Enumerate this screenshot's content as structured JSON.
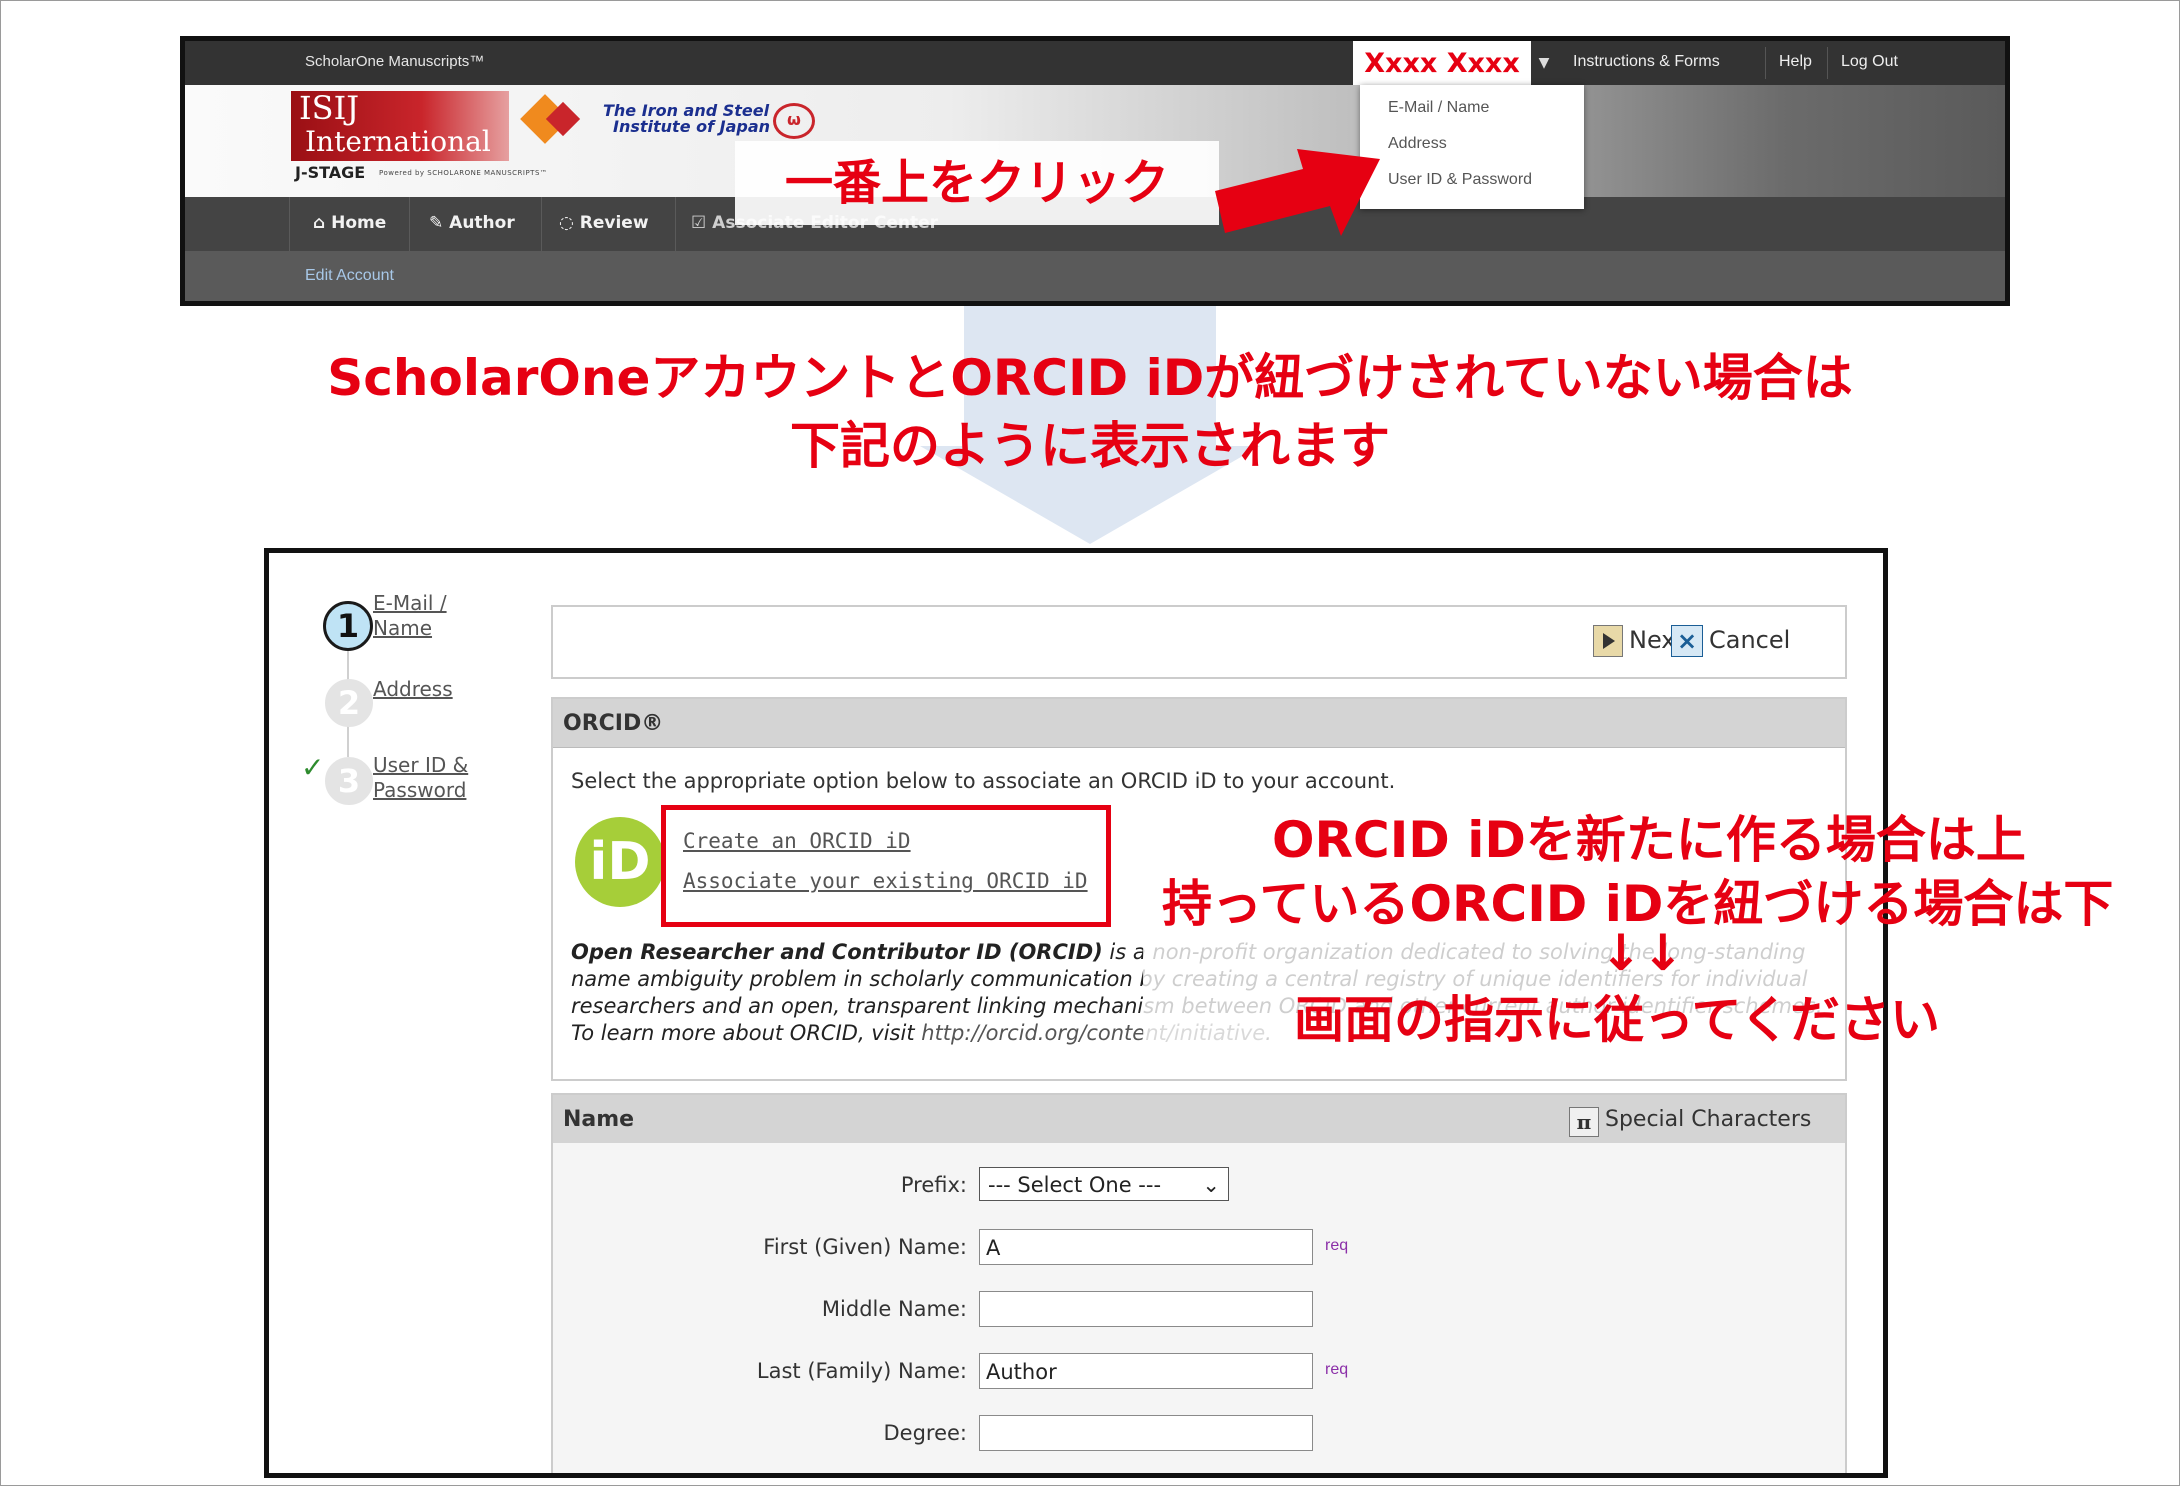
{
  "top_screenshot": {
    "app_name": "ScholarOne Manuscripts™",
    "user_name": "Xxxx Xxxx",
    "top_links": [
      "Instructions & Forms",
      "Help",
      "Log Out"
    ],
    "logo": {
      "line1": "ISIJ",
      "line2": "International",
      "org_line1": "The Iron and Steel",
      "org_line2": "Institute of Japan",
      "jstage": "J-STAGE",
      "powered": "Powered by SCHOLARONE MANUSCRIPTS™"
    },
    "nav": {
      "home": "Home",
      "author": "Author",
      "review": "Review",
      "associate_editor": "Associate Editor Center"
    },
    "subnav": "Edit Account",
    "dropdown": [
      "E-Mail / Name",
      "Address",
      "User ID & Password"
    ],
    "callout": "一番上をクリック"
  },
  "headline": {
    "line1": "ScholarOneアカウントとORCID iDが紐づけされていない場合は",
    "line2": "下記のように表示されます"
  },
  "bottom_screenshot": {
    "steps": [
      {
        "number": "1",
        "label": "E-Mail / Name"
      },
      {
        "number": "2",
        "label": "Address"
      },
      {
        "number": "3",
        "label": "User ID & Password"
      }
    ],
    "buttons": {
      "next": "Next",
      "cancel": "Cancel"
    },
    "orcid": {
      "title": "ORCID®",
      "intro": "Select the appropriate option below to associate an ORCID iD to your account.",
      "logo_text": "iD",
      "create_link": "Create an ORCID iD",
      "associate_link": "Associate your existing ORCID iD",
      "desc_bold": "Open Researcher and Contributor ID (ORCID)",
      "desc_rest": " is a non-profit organization dedicated to solving the long-standing name ambiguity problem in scholarly communication by creating a central registry of unique identifiers for individual researchers and an open, transparent linking mechanism between ORCID and other current author identifier schemes. To learn more about ORCID, visit",
      "desc_url": "http://orcid.org/content/initiative",
      "desc_end": "."
    },
    "name_section": {
      "title": "Name",
      "special_characters": "Special Characters",
      "special_icon": "π",
      "prefix_label": "Prefix:",
      "prefix_value": "--- Select One ---",
      "first_label": "First (Given) Name:",
      "first_value": "A",
      "middle_label": "Middle Name:",
      "middle_value": "",
      "last_label": "Last (Family) Name:",
      "last_value": "Author",
      "degree_label": "Degree:",
      "degree_value": "",
      "req": "req"
    },
    "overlay": {
      "line1": "ORCID iDを新たに作る場合は上",
      "line2": "持っているORCID iDを紐づける場合は下",
      "arrows": "↓↓",
      "line3": "画面の指示に従ってください"
    }
  },
  "colors": {
    "accent_red": "#e60012",
    "orcid_green": "#a6ce39",
    "banner_red": "#c9252b"
  }
}
